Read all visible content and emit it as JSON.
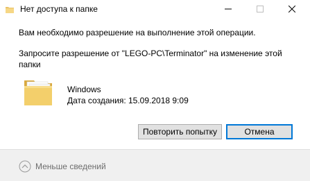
{
  "window": {
    "title": "Нет доступа к папке",
    "icons": {
      "app": "folder-icon",
      "minimize": "minimize-icon",
      "maximize": "maximize-icon",
      "close": "close-icon"
    }
  },
  "content": {
    "message1": "Вам необходимо разрешение на выполнение этой операции.",
    "message2": "Запросите разрешение от \"LEGO-PC\\Terminator\" на изменение этой папки",
    "item": {
      "icon": "folder-icon",
      "name": "Windows",
      "date_created": "Дата создания: 15.09.2018 9:09"
    }
  },
  "buttons": {
    "retry": "Повторить попытку",
    "cancel": "Отмена"
  },
  "footer": {
    "toggle_icon": "chevron-up-icon",
    "less_details": "Меньше сведений"
  },
  "colors": {
    "accent": "#0078d7",
    "folder": "#e9c268",
    "button_bg": "#e1e1e1",
    "footer_bg": "#f0f0f0",
    "muted_text": "#6d6d6d"
  }
}
